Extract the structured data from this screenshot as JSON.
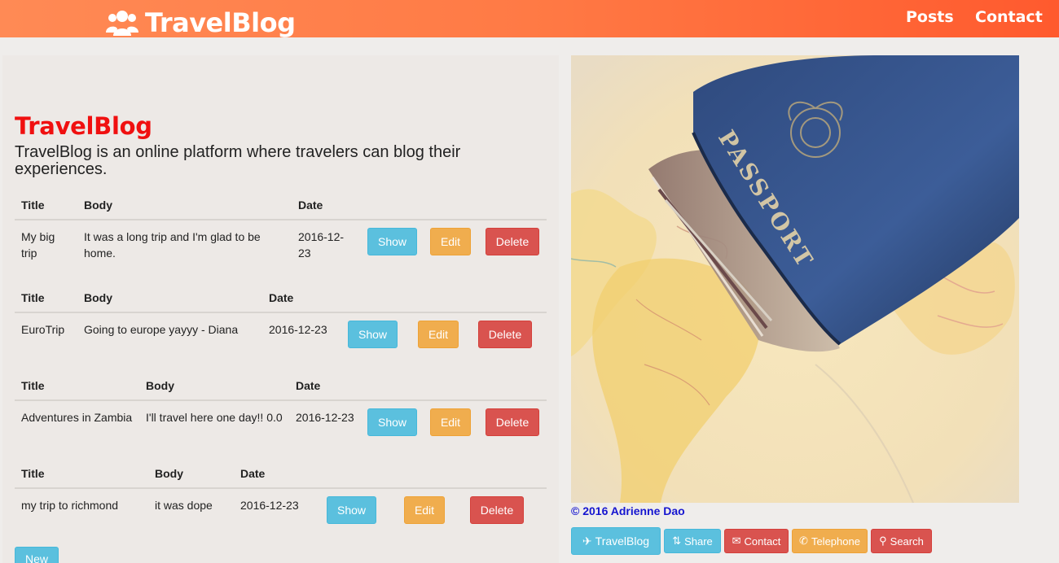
{
  "navbar": {
    "brand": "TravelBlog",
    "links": {
      "posts": "Posts",
      "contact": "Contact"
    }
  },
  "main": {
    "title": "TravelBlog",
    "intro": "TravelBlog is an online platform where travelers can blog their experiences."
  },
  "columns": {
    "title": "Title",
    "body": "Body",
    "date": "Date"
  },
  "actions": {
    "show": "Show",
    "edit": "Edit",
    "delete": "Delete",
    "new": "New"
  },
  "posts": [
    {
      "title": "My big trip",
      "body": "It was a long trip and I'm glad to be home.",
      "date": "2016-12-23"
    },
    {
      "title": "EuroTrip",
      "body": "Going to europe yayyy - Diana",
      "date": "2016-12-23"
    },
    {
      "title": "Adventures in Zambia",
      "body": "I'll travel here one day!! 0.0",
      "date": "2016-12-23"
    },
    {
      "title": "my trip to richmond",
      "body": "it was dope",
      "date": "2016-12-23"
    }
  ],
  "hero": {
    "passport_text": "PASSPORT"
  },
  "footer": {
    "copyright": "© 2016 Adrienne Dao",
    "buttons": {
      "travelblog": "TravelBlog",
      "share": "Share",
      "contact": "Contact",
      "telephone": "Telephone",
      "search": "Search"
    }
  },
  "colors": {
    "navbar_start": "#ff8a55",
    "navbar_end": "#ff5a2e",
    "title_red": "#f01010",
    "info": "#5bc0de",
    "warning": "#f0ad4e",
    "danger": "#d9534f",
    "link_blue": "#1515d0"
  }
}
